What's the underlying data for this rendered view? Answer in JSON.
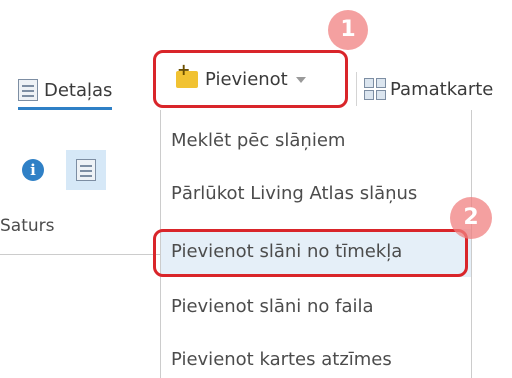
{
  "toolbar": {
    "details_label": "Detaļas",
    "add_label": "Pievienot",
    "basemap_label": "Pamatkarte"
  },
  "side_panel": {
    "section_label": "Saturs"
  },
  "dropdown": {
    "items": [
      "Meklēt pēc slāņiem",
      "Pārlūkot Living Atlas slāņus",
      "Pievienot slāni no tīmekļa",
      "Pievienot slāni no faila",
      "Pievienot kartes atzīmes"
    ],
    "highlighted_index": 2
  },
  "annotations": {
    "step1": "1",
    "step2": "2",
    "highlight_color": "#d9252a",
    "badge_color": "#f08080"
  },
  "colors": {
    "accent": "#2f80c6",
    "hover_bg": "#e5eff8",
    "folder": "#f1c232"
  },
  "icons": [
    "details-doc-icon",
    "add-folder-icon",
    "basemap-grid-icon",
    "info-icon",
    "content-doc-icon",
    "chevron-down-icon"
  ]
}
